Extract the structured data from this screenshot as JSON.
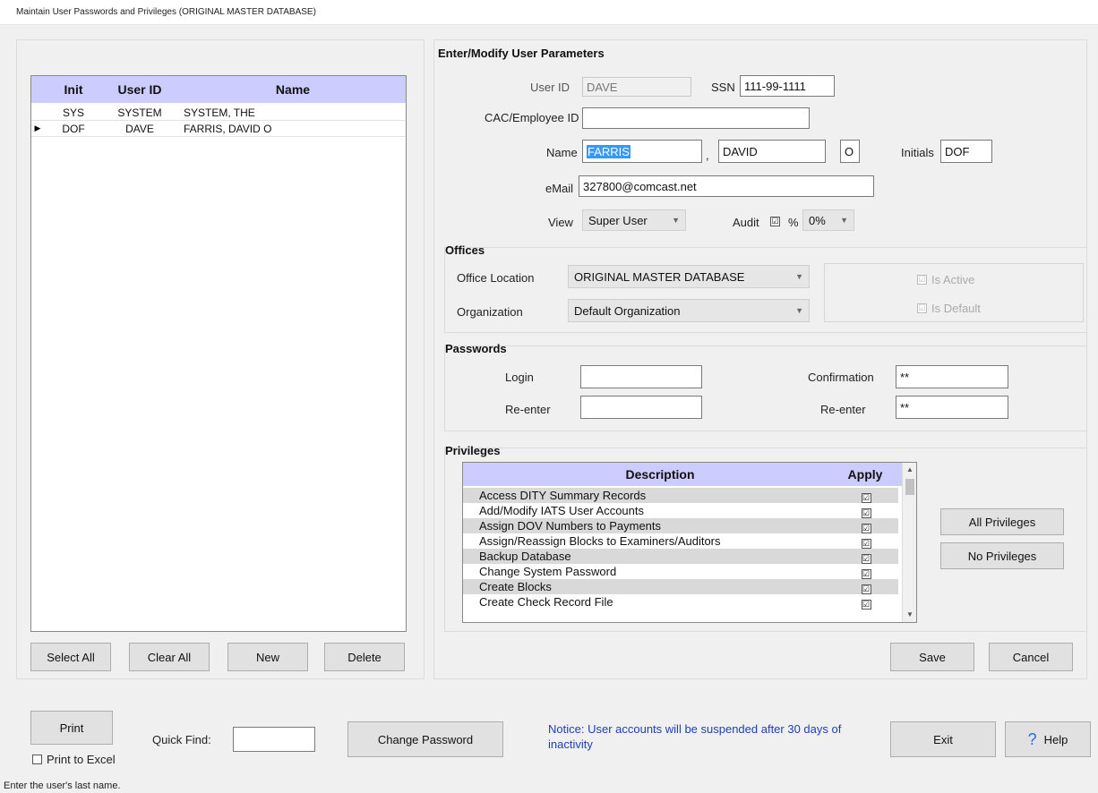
{
  "window": {
    "title": "Maintain User Passwords and Privileges (ORIGINAL MASTER DATABASE)"
  },
  "users_table": {
    "columns": [
      "Init",
      "User ID",
      "Name"
    ],
    "rows": [
      {
        "init": "SYS",
        "user_id": "SYSTEM",
        "name": "SYSTEM, THE"
      },
      {
        "init": "DOF",
        "user_id": "DAVE",
        "name": "FARRIS, DAVID O"
      }
    ],
    "current_row_marker": "▶"
  },
  "list_buttons": {
    "select_all": "Select All",
    "clear_all": "Clear All",
    "new": "New",
    "delete": "Delete"
  },
  "params": {
    "section_title": "Enter/Modify User Parameters",
    "user_id_label": "User ID",
    "user_id_value": "DAVE",
    "ssn_label": "SSN",
    "ssn_value": "111-99-1111",
    "cac_label": "CAC/Employee ID",
    "cac_value": "",
    "name_label": "Name",
    "last_name": "FARRIS",
    "comma": ",",
    "first_name": "DAVID",
    "middle_initial": "O",
    "initials_label": "Initials",
    "initials_value": "DOF",
    "email_label": "eMail",
    "email_value": "327800@comcast.net",
    "view_label": "View",
    "view_value": "Super User",
    "audit_label": "Audit",
    "audit_checked": "☑",
    "percent_label": "%",
    "percent_value": "0%"
  },
  "offices": {
    "section_title": "Offices",
    "location_label": "Office Location",
    "location_value": "ORIGINAL MASTER DATABASE",
    "org_label": "Organization",
    "org_value": "Default Organization",
    "is_active_label": "Is Active",
    "is_default_label": "Is Default",
    "check_mark": "☑"
  },
  "passwords": {
    "section_title": "Passwords",
    "login_label": "Login",
    "login_value": "",
    "reenter_label": "Re-enter",
    "reenter_value": "",
    "confirmation_label": "Confirmation",
    "confirmation_value": "**",
    "reenter2_label": "Re-enter",
    "reenter2_value": "**"
  },
  "privileges": {
    "section_title": "Privileges",
    "columns": [
      "Description",
      "Apply"
    ],
    "rows": [
      {
        "description": "Access DITY Summary Records",
        "apply": "☑"
      },
      {
        "description": "Add/Modify IATS User Accounts",
        "apply": "☑"
      },
      {
        "description": "Assign DOV Numbers to Payments",
        "apply": "☑"
      },
      {
        "description": "Assign/Reassign Blocks to Examiners/Auditors",
        "apply": "☑"
      },
      {
        "description": "Backup Database",
        "apply": "☑"
      },
      {
        "description": "Change System Password",
        "apply": "☑"
      },
      {
        "description": "Create Blocks",
        "apply": "☑"
      },
      {
        "description": "Create Check Record File",
        "apply": "☑"
      }
    ],
    "all_button": "All Privileges",
    "none_button": "No Privileges"
  },
  "form_buttons": {
    "save": "Save",
    "cancel": "Cancel"
  },
  "footer": {
    "print": "Print",
    "print_to_excel": "Print to Excel",
    "quick_find_label": "Quick Find:",
    "quick_find_value": "",
    "change_password": "Change Password",
    "notice": "Notice: User accounts will be suspended after 30 days of inactivity",
    "exit": "Exit",
    "help": "Help",
    "help_glyph": "?"
  },
  "status_bar": {
    "text": "Enter the user's last name."
  },
  "colors": {
    "grid_header": "#ccccff",
    "notice_text": "#1f3fb4",
    "selection": "#3399ff"
  }
}
